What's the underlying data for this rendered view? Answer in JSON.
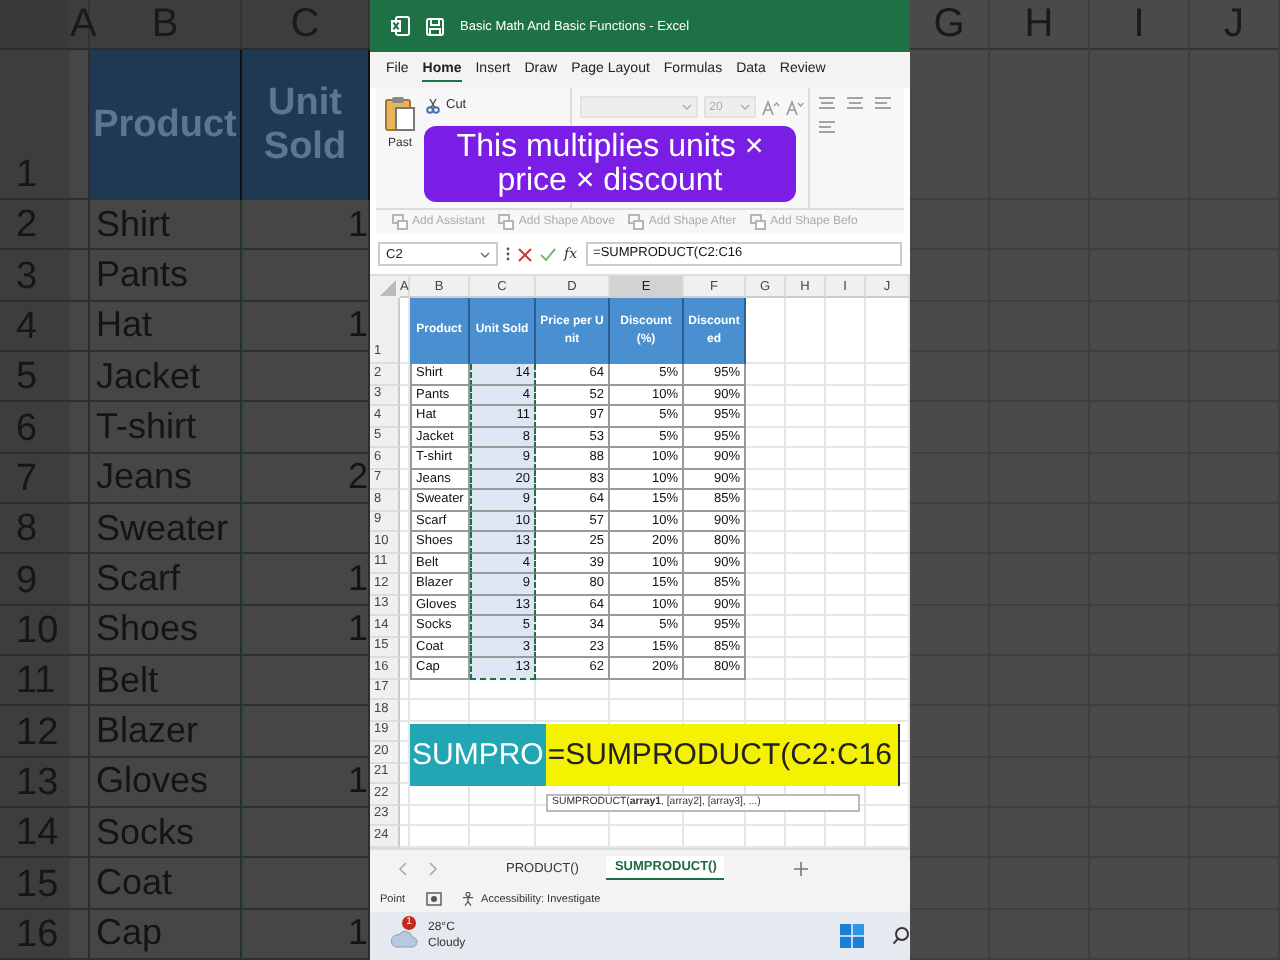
{
  "left_zoom": {
    "column_letters": [
      "A",
      "B",
      "C"
    ],
    "header_row": "1",
    "headers": [
      "Product",
      "Unit Sold"
    ],
    "rows": [
      {
        "row": "2",
        "product": "Shirt",
        "units": "1"
      },
      {
        "row": "3",
        "product": "Pants"
      },
      {
        "row": "4",
        "product": "Hat",
        "units": "1"
      },
      {
        "row": "5",
        "product": "Jacket"
      },
      {
        "row": "6",
        "product": "T-shirt"
      },
      {
        "row": "7",
        "product": "Jeans",
        "units": "2"
      },
      {
        "row": "8",
        "product": "Sweater"
      },
      {
        "row": "9",
        "product": "Scarf",
        "units": "1"
      },
      {
        "row": "10",
        "product": "Shoes",
        "units": "1"
      },
      {
        "row": "11",
        "product": "Belt"
      },
      {
        "row": "12",
        "product": "Blazer"
      },
      {
        "row": "13",
        "product": "Gloves",
        "units": "1"
      },
      {
        "row": "14",
        "product": "Socks"
      },
      {
        "row": "15",
        "product": "Coat"
      },
      {
        "row": "16",
        "product": "Cap",
        "units": "1"
      }
    ]
  },
  "right_zoom": {
    "column_letters": [
      "G",
      "H",
      "I",
      "J"
    ]
  },
  "window": {
    "title": "Basic Math And Basic Functions - Excel"
  },
  "menu": [
    {
      "label": "File",
      "selected": false
    },
    {
      "label": "Home",
      "selected": true
    },
    {
      "label": "Insert",
      "selected": false
    },
    {
      "label": "Draw",
      "selected": false
    },
    {
      "label": "Page Layout",
      "selected": false
    },
    {
      "label": "Formulas",
      "selected": false
    },
    {
      "label": "Data",
      "selected": false
    },
    {
      "label": "Review",
      "selected": false
    }
  ],
  "ribbon": {
    "paste": "Past",
    "cut": "Cut",
    "font_size": "20",
    "smartart": [
      {
        "label": "Add Assistant",
        "disabled": true
      },
      {
        "label": "Add Shape Above",
        "disabled": true
      },
      {
        "label": "Add Shape After",
        "disabled": true
      },
      {
        "label": "Add Shape Befo",
        "disabled": true
      }
    ]
  },
  "caption": "This multiplies units × price × discount",
  "formula_bar": {
    "name_box": "C2",
    "function_label": "fx",
    "formula": "=SUMPRODUCT(C2:C16"
  },
  "sheet": {
    "column_letters": [
      {
        "label": "A",
        "selected": false
      },
      {
        "label": "B",
        "selected": false
      },
      {
        "label": "C",
        "selected": false
      },
      {
        "label": "D",
        "selected": false
      },
      {
        "label": "E",
        "selected": true
      },
      {
        "label": "F",
        "selected": false
      },
      {
        "label": "G",
        "selected": false
      },
      {
        "label": "H",
        "selected": false
      },
      {
        "label": "I",
        "selected": false
      },
      {
        "label": "J",
        "selected": false
      }
    ],
    "header_row": "1",
    "headers": [
      {
        "label": "Product",
        "copy_range": false
      },
      {
        "label": "Unit Sold",
        "copy_range": true
      },
      {
        "label": "Price per Unit",
        "copy_range": false
      },
      {
        "label": "Discount (%)",
        "copy_range": false
      },
      {
        "label": "Discounted",
        "copy_range": false
      }
    ],
    "rows": [
      {
        "row": "2",
        "cells": [
          "Shirt",
          "14",
          "64",
          "5%",
          "95%"
        ]
      },
      {
        "row": "3",
        "cells": [
          "Pants",
          "4",
          "52",
          "10%",
          "90%"
        ]
      },
      {
        "row": "4",
        "cells": [
          "Hat",
          "11",
          "97",
          "5%",
          "95%"
        ]
      },
      {
        "row": "5",
        "cells": [
          "Jacket",
          "8",
          "53",
          "5%",
          "95%"
        ]
      },
      {
        "row": "6",
        "cells": [
          "T-shirt",
          "9",
          "88",
          "10%",
          "90%"
        ]
      },
      {
        "row": "7",
        "cells": [
          "Jeans",
          "20",
          "83",
          "10%",
          "90%"
        ]
      },
      {
        "row": "8",
        "cells": [
          "Sweater",
          "9",
          "64",
          "15%",
          "85%"
        ]
      },
      {
        "row": "9",
        "cells": [
          "Scarf",
          "10",
          "57",
          "10%",
          "90%"
        ]
      },
      {
        "row": "10",
        "cells": [
          "Shoes",
          "13",
          "25",
          "20%",
          "80%"
        ]
      },
      {
        "row": "11",
        "cells": [
          "Belt",
          "4",
          "39",
          "10%",
          "90%"
        ]
      },
      {
        "row": "12",
        "cells": [
          "Blazer",
          "9",
          "80",
          "15%",
          "85%"
        ]
      },
      {
        "row": "13",
        "cells": [
          "Gloves",
          "13",
          "64",
          "10%",
          "90%"
        ]
      },
      {
        "row": "14",
        "cells": [
          "Socks",
          "5",
          "34",
          "5%",
          "95%"
        ]
      },
      {
        "row": "15",
        "cells": [
          "Coat",
          "3",
          "23",
          "15%",
          "85%"
        ]
      },
      {
        "row": "16",
        "cells": [
          "Cap",
          "13",
          "62",
          "20%",
          "80%"
        ]
      }
    ],
    "empty_rows": [
      "17",
      "18",
      "19",
      "20",
      "21",
      "22",
      "23",
      "24"
    ]
  },
  "formula_overlay": {
    "label": "SUMPRO",
    "formula": "=SUMPRODUCT(C2:C16"
  },
  "tooltip": "SUMPRODUCT(**array1**, [array2], [array3], ...)",
  "sheet_tabs": [
    {
      "label": "PRODUCT()",
      "selected": false
    },
    {
      "label": "SUMPRODUCT()",
      "selected": true
    }
  ],
  "status_bar": {
    "mode": "Point",
    "accessibility": "Accessibility: Investigate"
  },
  "taskbar": {
    "weather_badge": "1",
    "temperature": "28°C",
    "condition": "Cloudy"
  }
}
